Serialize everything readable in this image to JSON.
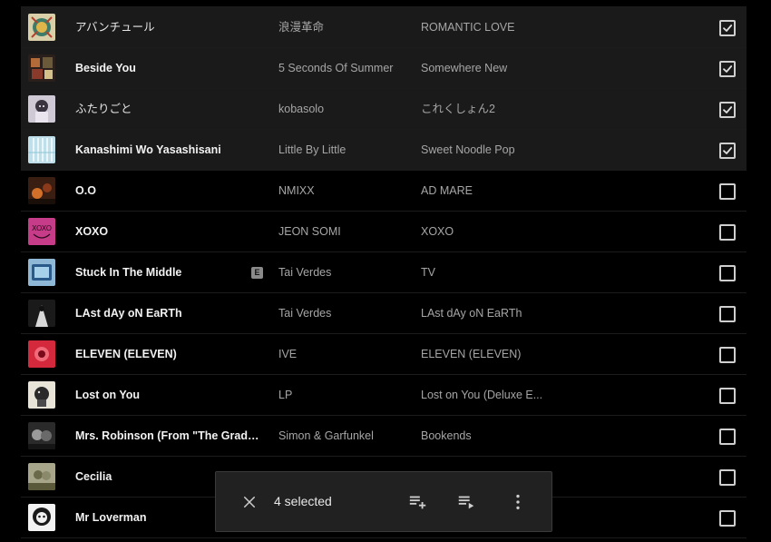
{
  "tracks": [
    {
      "title": "",
      "artist": "",
      "album": "",
      "selected": false,
      "explicit": false,
      "thumb": "art-partial"
    },
    {
      "title": "アバンチュール",
      "artist": "浪漫革命",
      "album": "ROMANTIC LOVE",
      "selected": true,
      "explicit": false,
      "thumb": "art-avanture"
    },
    {
      "title": "Beside You",
      "artist": "5 Seconds Of Summer",
      "album": "Somewhere New",
      "selected": true,
      "explicit": false,
      "thumb": "art-beside"
    },
    {
      "title": "ふたりごと",
      "artist": "kobasolo",
      "album": "これくしょん2",
      "selected": true,
      "explicit": false,
      "thumb": "art-futari"
    },
    {
      "title": "Kanashimi Wo Yasashisani",
      "artist": "Little By Little",
      "album": "Sweet Noodle Pop",
      "selected": true,
      "explicit": false,
      "thumb": "art-kanashimi"
    },
    {
      "title": "O.O",
      "artist": "NMIXX",
      "album": "AD MARE",
      "selected": false,
      "explicit": false,
      "thumb": "art-oo"
    },
    {
      "title": "XOXO",
      "artist": "JEON SOMI",
      "album": "XOXO",
      "selected": false,
      "explicit": false,
      "thumb": "art-xoxo"
    },
    {
      "title": "Stuck In The Middle",
      "artist": "Tai Verdes",
      "album": "TV",
      "selected": false,
      "explicit": true,
      "thumb": "art-tv"
    },
    {
      "title": "LAst dAy oN EaRTh",
      "artist": "Tai Verdes",
      "album": "LAst dAy oN EaRTh",
      "selected": false,
      "explicit": false,
      "thumb": "art-lastday"
    },
    {
      "title": "ELEVEN (ELEVEN)",
      "artist": "IVE",
      "album": "ELEVEN (ELEVEN)",
      "selected": false,
      "explicit": false,
      "thumb": "art-eleven"
    },
    {
      "title": "Lost on You",
      "artist": "LP",
      "album": "Lost on You (Deluxe E...",
      "selected": false,
      "explicit": false,
      "thumb": "art-lp"
    },
    {
      "title": "Mrs. Robinson (From \"The Gradua...",
      "artist": "Simon & Garfunkel",
      "album": "Bookends",
      "selected": false,
      "explicit": false,
      "thumb": "art-bookends"
    },
    {
      "title": "Cecilia",
      "artist": "",
      "album": "",
      "selected": false,
      "explicit": false,
      "thumb": "art-cecilia"
    },
    {
      "title": "Mr Loverman",
      "artist": "",
      "album": "",
      "selected": false,
      "explicit": false,
      "thumb": "art-loverman"
    }
  ],
  "explicit_badge": "E",
  "selection_bar": {
    "count_label": "4 selected",
    "actions": [
      {
        "name": "add-to-playlist-icon"
      },
      {
        "name": "add-to-queue-icon"
      },
      {
        "name": "more-options-icon"
      }
    ]
  },
  "colors": {
    "background": "#000000",
    "selected_row": "#1a1a1a",
    "toolbar": "#212121",
    "secondary_text": "#a6a6a6"
  }
}
